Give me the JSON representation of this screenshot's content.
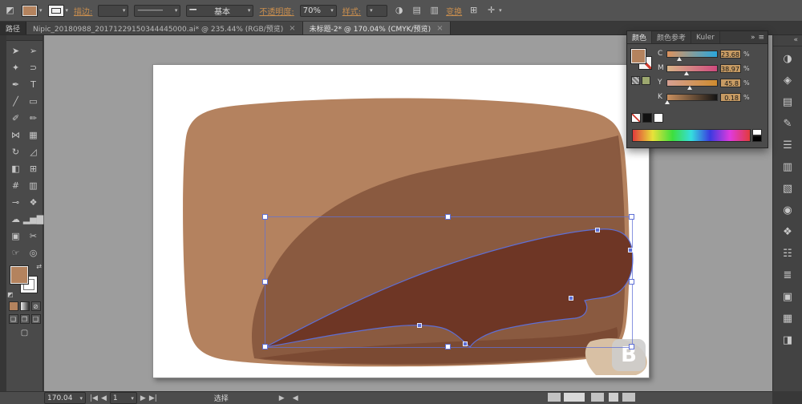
{
  "window": {
    "path_panel_label": "路径"
  },
  "control_bar": {
    "fill_color": "#b4835e",
    "stroke_label": "描边:",
    "profile_line_glyph": "————",
    "brush_line_glyph": "━━",
    "brush_definition": "基本",
    "opacity_label": "不透明度:",
    "opacity_value": "70%",
    "style_label": "样式:",
    "transform_label": "变换",
    "caret_glyph": "▾",
    "icons": {
      "app_swatch": "◩",
      "recolor": "◑",
      "align_h": "▤",
      "align_v": "▥",
      "grid": "⊞",
      "reference_point": "✛"
    }
  },
  "document_tabs": [
    {
      "title": "Nipic_20180988_20171229150344445000.ai* @ 235.44% (RGB/预览)",
      "close_glyph": "×",
      "active": false
    },
    {
      "title": "未标题-2* @ 170.04% (CMYK/预览)",
      "close_glyph": "×",
      "active": true
    }
  ],
  "toolbar": {
    "swap_glyph": "⇄",
    "bw_glyph": "◩",
    "screen_mode_glyph": "▢",
    "tools": [
      {
        "name": "selection",
        "glyph": "➤"
      },
      {
        "name": "direct-selection",
        "glyph": "➢"
      },
      {
        "name": "magic-wand",
        "glyph": "✦"
      },
      {
        "name": "lasso",
        "glyph": "⊃"
      },
      {
        "name": "pen",
        "glyph": "✒"
      },
      {
        "name": "type",
        "glyph": "T"
      },
      {
        "name": "line-segment",
        "glyph": "╱"
      },
      {
        "name": "rectangle",
        "glyph": "▭"
      },
      {
        "name": "paintbrush",
        "glyph": "✐"
      },
      {
        "name": "pencil",
        "glyph": "✏"
      },
      {
        "name": "width",
        "glyph": "⋈"
      },
      {
        "name": "free-transform",
        "glyph": "▦"
      },
      {
        "name": "rotate",
        "glyph": "↻"
      },
      {
        "name": "scale",
        "glyph": "◿"
      },
      {
        "name": "shape-builder",
        "glyph": "◧"
      },
      {
        "name": "perspective-grid",
        "glyph": "⊞"
      },
      {
        "name": "mesh",
        "glyph": "#"
      },
      {
        "name": "gradient",
        "glyph": "▥"
      },
      {
        "name": "eyedropper",
        "glyph": "⊸"
      },
      {
        "name": "blend",
        "glyph": "❖"
      },
      {
        "name": "symbol-sprayer",
        "glyph": "☁"
      },
      {
        "name": "column-graph",
        "glyph": "▂▅▇"
      },
      {
        "name": "artboard",
        "glyph": "▣"
      },
      {
        "name": "slice",
        "glyph": "✂"
      },
      {
        "name": "hand",
        "glyph": "☞"
      },
      {
        "name": "zoom",
        "glyph": "◎"
      }
    ],
    "mini_buttons": [
      {
        "name": "color-button",
        "glyph": ""
      },
      {
        "name": "gradient-button",
        "glyph": ""
      },
      {
        "name": "none-button",
        "glyph": "⊘"
      }
    ],
    "mode_buttons": [
      {
        "name": "draw-normal-button",
        "glyph": "❏"
      },
      {
        "name": "draw-behind-button",
        "glyph": "❐"
      },
      {
        "name": "draw-inside-button",
        "glyph": "❑"
      }
    ]
  },
  "color_panel": {
    "tabs": [
      {
        "label": "颜色",
        "active": true
      },
      {
        "label": "颜色参考",
        "active": false
      },
      {
        "label": "Kuler",
        "active": false
      }
    ],
    "expand_glyph": "»",
    "menu_glyph": "≡",
    "sliders": [
      {
        "channel": "C",
        "value": "23.68",
        "unit": "%"
      },
      {
        "channel": "M",
        "value": "38.97",
        "unit": "%"
      },
      {
        "channel": "Y",
        "value": "45.8",
        "unit": "%"
      },
      {
        "channel": "K",
        "value": "0.18",
        "unit": "%"
      }
    ]
  },
  "right_dock": {
    "expand_glyph": "«",
    "icons": [
      {
        "name": "color",
        "glyph": "◑"
      },
      {
        "name": "color-guide",
        "glyph": "◈"
      },
      {
        "name": "swatches",
        "glyph": "▤"
      },
      {
        "name": "brushes",
        "glyph": "✎"
      },
      {
        "name": "stroke",
        "glyph": "☰"
      },
      {
        "name": "gradient",
        "glyph": "▥"
      },
      {
        "name": "transparency",
        "glyph": "▧"
      },
      {
        "name": "appearance",
        "glyph": "◉"
      },
      {
        "name": "graphic-styles",
        "glyph": "❖"
      },
      {
        "name": "symbols",
        "glyph": "☷"
      },
      {
        "name": "layers",
        "glyph": "≣"
      },
      {
        "name": "artboards",
        "glyph": "▣"
      },
      {
        "name": "align",
        "glyph": "▦"
      },
      {
        "name": "pathfinder",
        "glyph": "◨"
      }
    ]
  },
  "artwork": {
    "light_brown": "#b4825f",
    "mid_brown": "#8a5a40",
    "shadow_brown": "#7b4a33",
    "selected_brown": "#6e3625",
    "blob_tan": "#d8c0a4",
    "selection_blue": "#5e6fd6",
    "watermark_letter": "B"
  },
  "status_bar": {
    "zoom_value": "170.04",
    "nav_first": "|◀",
    "nav_prev": "◀",
    "artboard_value": "1",
    "nav_next": "▶",
    "nav_last": "▶|",
    "mode_text": "选择",
    "expand_right": "▶",
    "collapse_left": "◀"
  }
}
